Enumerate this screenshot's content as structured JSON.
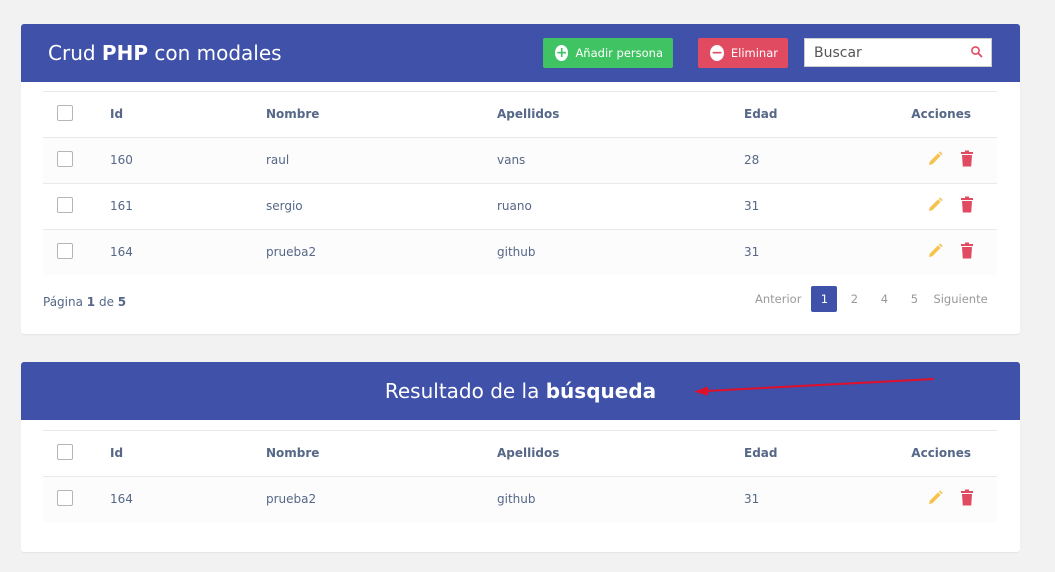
{
  "header": {
    "title_prefix": "Crud ",
    "title_bold": "PHP",
    "title_suffix": " con modales",
    "add_button": "Añadir persona",
    "delete_button": "Eliminar",
    "search_placeholder": "Buscar"
  },
  "columns": {
    "id": "Id",
    "nombre": "Nombre",
    "apellidos": "Apellidos",
    "edad": "Edad",
    "acciones": "Acciones"
  },
  "rows": [
    {
      "id": "160",
      "nombre": "raul",
      "apellidos": "vans",
      "edad": "28"
    },
    {
      "id": "161",
      "nombre": "sergio",
      "apellidos": "ruano",
      "edad": "31"
    },
    {
      "id": "164",
      "nombre": "prueba2",
      "apellidos": "github",
      "edad": "31"
    }
  ],
  "pagination": {
    "label_page": "Página ",
    "current": "1",
    "label_of": " de ",
    "total": "5",
    "prev": "Anterior",
    "pages": [
      "1",
      "2",
      "4",
      "5"
    ],
    "next": "Siguiente"
  },
  "result": {
    "title_prefix": "Resultado de la ",
    "title_bold": "búsqueda",
    "rows": [
      {
        "id": "164",
        "nombre": "prueba2",
        "apellidos": "github",
        "edad": "31"
      }
    ]
  },
  "colors": {
    "header_bg": "#3f51a8",
    "add_green": "#40c463",
    "delete_red": "#e04b62",
    "edit_yellow": "#f5c34e",
    "arrow_red": "#e0102a"
  },
  "icons": {
    "edit": "pencil-icon",
    "delete": "trash-icon",
    "search": "magnifier-icon",
    "add": "plus-circle-icon",
    "remove": "minus-circle-icon"
  }
}
